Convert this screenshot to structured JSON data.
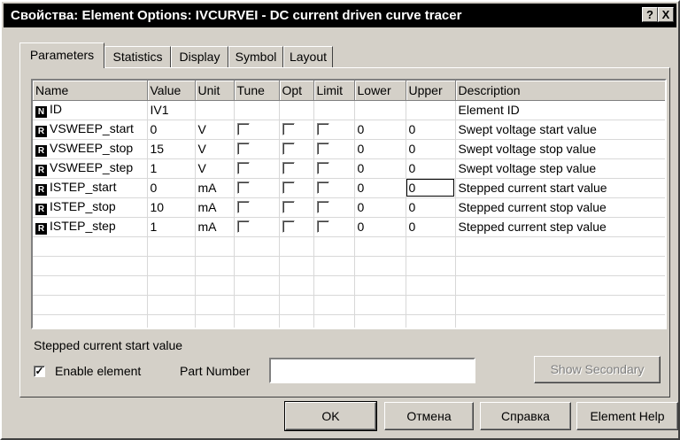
{
  "window": {
    "title": "Свойства: Element Options: IVCURVEI - DC current driven curve tracer",
    "help_btn": "?",
    "close_btn": "X"
  },
  "tabs": [
    {
      "label": "Parameters"
    },
    {
      "label": "Statistics"
    },
    {
      "label": "Display"
    },
    {
      "label": "Symbol"
    },
    {
      "label": "Layout"
    }
  ],
  "table": {
    "headers": {
      "name": "Name",
      "value": "Value",
      "unit": "Unit",
      "tune": "Tune",
      "opt": "Opt",
      "limit": "Limit",
      "lower": "Lower",
      "upper": "Upper",
      "description": "Description"
    },
    "rows": [
      {
        "badge": "N",
        "name": "ID",
        "value": "IV1",
        "unit": "",
        "lower": "",
        "upper": "",
        "description": "Element ID"
      },
      {
        "badge": "R",
        "name": "VSWEEP_start",
        "value": "0",
        "unit": "V",
        "lower": "0",
        "upper": "0",
        "description": "Swept voltage start value"
      },
      {
        "badge": "R",
        "name": "VSWEEP_stop",
        "value": "15",
        "unit": "V",
        "lower": "0",
        "upper": "0",
        "description": "Swept voltage stop value"
      },
      {
        "badge": "R",
        "name": "VSWEEP_step",
        "value": "1",
        "unit": "V",
        "lower": "0",
        "upper": "0",
        "description": "Swept voltage step value"
      },
      {
        "badge": "R",
        "name": "ISTEP_start",
        "value": "0",
        "unit": "mA",
        "lower": "0",
        "upper": "0",
        "description": "Stepped current start value"
      },
      {
        "badge": "R",
        "name": "ISTEP_stop",
        "value": "10",
        "unit": "mA",
        "lower": "0",
        "upper": "0",
        "description": "Stepped current stop value"
      },
      {
        "badge": "R",
        "name": "ISTEP_step",
        "value": "1",
        "unit": "mA",
        "lower": "0",
        "upper": "0",
        "description": "Stepped current step value"
      }
    ]
  },
  "status_text": "Stepped current start value",
  "enable_element": {
    "label": "Enable element",
    "checked": true,
    "mark": "✓"
  },
  "part_number": {
    "label": "Part Number",
    "value": ""
  },
  "buttons": {
    "show_secondary": "Show Secondary",
    "ok": "OK",
    "cancel": "Отмена",
    "help": "Справка",
    "element_help": "Element Help"
  }
}
